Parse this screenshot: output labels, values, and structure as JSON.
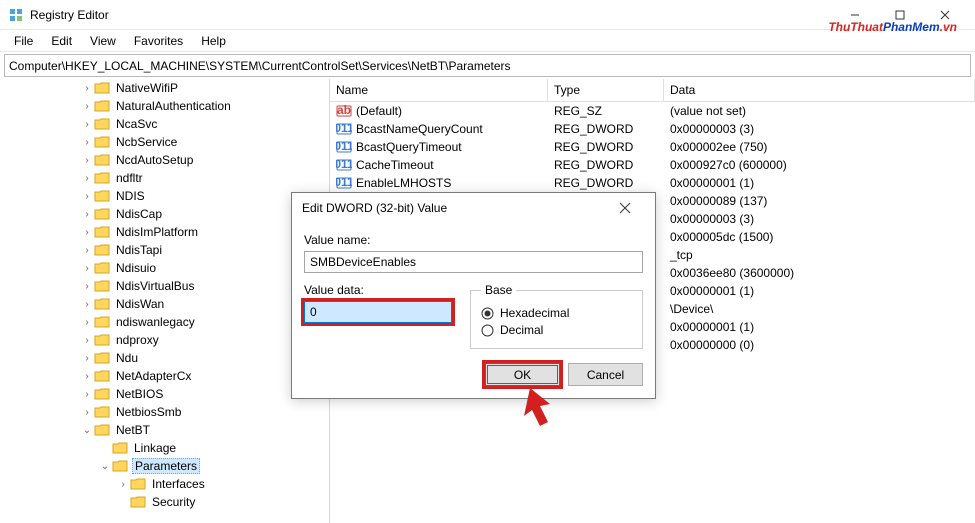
{
  "window": {
    "title": "Registry Editor"
  },
  "watermark": {
    "a": "ThuThuat",
    "b": "PhanMem",
    "c": ".vn"
  },
  "menu": {
    "file": "File",
    "edit": "Edit",
    "view": "View",
    "favorites": "Favorites",
    "help": "Help"
  },
  "address": "Computer\\HKEY_LOCAL_MACHINE\\SYSTEM\\CurrentControlSet\\Services\\NetBT\\Parameters",
  "tree": {
    "items": [
      {
        "indent": 80,
        "exp": ">",
        "label": "NativeWifiP"
      },
      {
        "indent": 80,
        "exp": ">",
        "label": "NaturalAuthentication"
      },
      {
        "indent": 80,
        "exp": ">",
        "label": "NcaSvc"
      },
      {
        "indent": 80,
        "exp": ">",
        "label": "NcbService"
      },
      {
        "indent": 80,
        "exp": ">",
        "label": "NcdAutoSetup"
      },
      {
        "indent": 80,
        "exp": ">",
        "label": "ndfltr"
      },
      {
        "indent": 80,
        "exp": ">",
        "label": "NDIS"
      },
      {
        "indent": 80,
        "exp": ">",
        "label": "NdisCap"
      },
      {
        "indent": 80,
        "exp": ">",
        "label": "NdisImPlatform"
      },
      {
        "indent": 80,
        "exp": ">",
        "label": "NdisTapi"
      },
      {
        "indent": 80,
        "exp": ">",
        "label": "Ndisuio"
      },
      {
        "indent": 80,
        "exp": ">",
        "label": "NdisVirtualBus"
      },
      {
        "indent": 80,
        "exp": ">",
        "label": "NdisWan"
      },
      {
        "indent": 80,
        "exp": ">",
        "label": "ndiswanlegacy"
      },
      {
        "indent": 80,
        "exp": ">",
        "label": "ndproxy"
      },
      {
        "indent": 80,
        "exp": ">",
        "label": "Ndu"
      },
      {
        "indent": 80,
        "exp": ">",
        "label": "NetAdapterCx"
      },
      {
        "indent": 80,
        "exp": ">",
        "label": "NetBIOS"
      },
      {
        "indent": 80,
        "exp": ">",
        "label": "NetbiosSmb"
      },
      {
        "indent": 80,
        "exp": "v",
        "label": "NetBT"
      },
      {
        "indent": 98,
        "exp": "",
        "label": "Linkage"
      },
      {
        "indent": 98,
        "exp": "v",
        "label": "Parameters",
        "selected": true
      },
      {
        "indent": 116,
        "exp": ">",
        "label": "Interfaces"
      },
      {
        "indent": 116,
        "exp": "",
        "label": "Security"
      }
    ]
  },
  "list": {
    "columns": {
      "name": "Name",
      "type": "Type",
      "data": "Data"
    },
    "rows": [
      {
        "icon": "ab",
        "name": "(Default)",
        "type": "REG_SZ",
        "data": "(value not set)"
      },
      {
        "icon": "bin",
        "name": "BcastNameQueryCount",
        "type": "REG_DWORD",
        "data": "0x00000003 (3)"
      },
      {
        "icon": "bin",
        "name": "BcastQueryTimeout",
        "type": "REG_DWORD",
        "data": "0x000002ee (750)"
      },
      {
        "icon": "bin",
        "name": "CacheTimeout",
        "type": "REG_DWORD",
        "data": "0x000927c0 (600000)"
      },
      {
        "icon": "bin",
        "name": "EnableLMHOSTS",
        "type": "REG_DWORD",
        "data": "0x00000001 (1)"
      },
      {
        "icon": "",
        "name": "",
        "type": "",
        "data": "0x00000089 (137)"
      },
      {
        "icon": "",
        "name": "",
        "type": "",
        "data": "0x00000003 (3)"
      },
      {
        "icon": "",
        "name": "",
        "type": "",
        "data": "0x000005dc (1500)"
      },
      {
        "icon": "",
        "name": "",
        "type": "",
        "data": "_tcp"
      },
      {
        "icon": "",
        "name": "",
        "type": "",
        "data": "0x0036ee80 (3600000)"
      },
      {
        "icon": "",
        "name": "",
        "type": "",
        "data": "0x00000001 (1)"
      },
      {
        "icon": "",
        "name": "",
        "type": "",
        "data": "\\Device\\"
      },
      {
        "icon": "",
        "name": "",
        "type": "",
        "data": "0x00000001 (1)"
      },
      {
        "icon": "",
        "name": "",
        "type": "",
        "data": "0x00000000 (0)"
      }
    ]
  },
  "dialog": {
    "title": "Edit DWORD (32-bit) Value",
    "valuename_label": "Value name:",
    "valuename": "SMBDeviceEnables",
    "valuedata_label": "Value data:",
    "valuedata": "0",
    "base_label": "Base",
    "hex_label": "Hexadecimal",
    "dec_label": "Decimal",
    "ok": "OK",
    "cancel": "Cancel"
  }
}
